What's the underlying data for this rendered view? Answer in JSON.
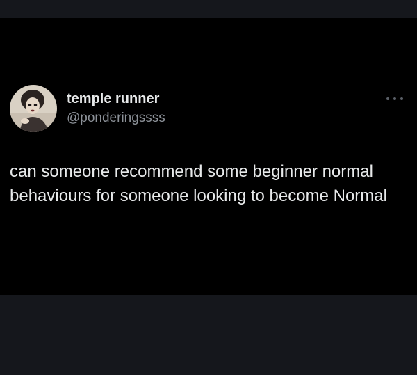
{
  "tweet": {
    "author": {
      "display_name": "temple runner",
      "handle": "@ponderingssss",
      "avatar_icon": "profile-photo"
    },
    "more_icon": "more-horizontal-icon",
    "text": "can someone recommend some beginner normal behaviours for someone looking to become Normal"
  },
  "colors": {
    "background": "#000000",
    "frame": "#15171c",
    "primary_text": "#e7e9ea",
    "secondary_text": "#8b9097"
  }
}
